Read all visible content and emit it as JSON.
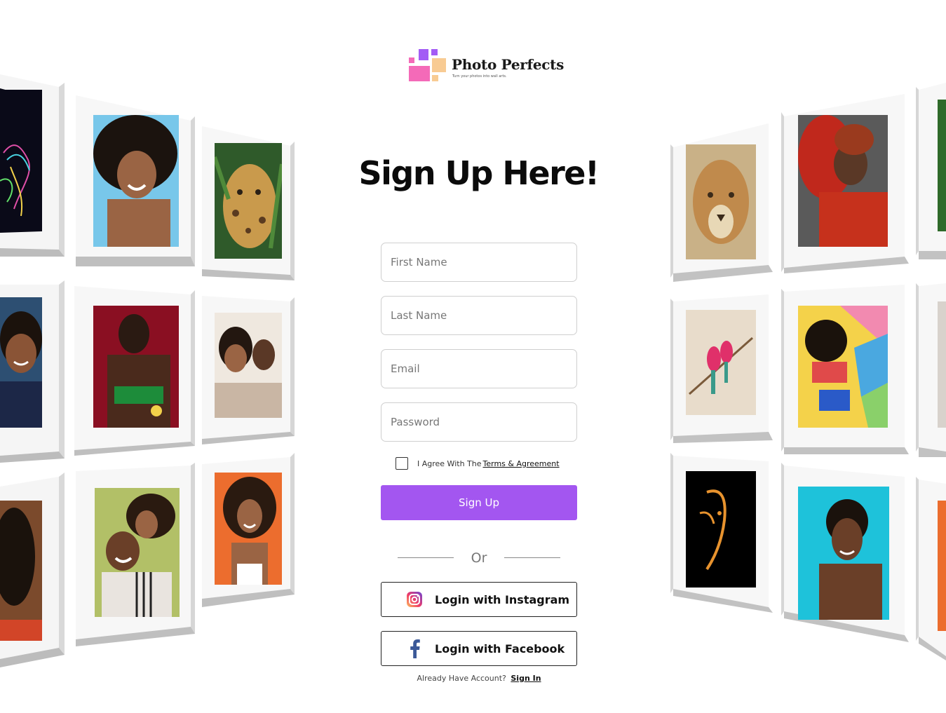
{
  "logo": {
    "brand": "Photo Perfects",
    "tagline": "Turn your photos into wall arts."
  },
  "page": {
    "title": "Sign Up Here!"
  },
  "form": {
    "first_name_placeholder": "First Name",
    "last_name_placeholder": "Last Name",
    "email_placeholder": "Email",
    "password_placeholder": "Password",
    "agree_text": "I Agree With The",
    "terms_link": "Terms & Agreement",
    "submit_label": "Sign Up",
    "divider": "Or",
    "instagram_label": "Login with Instagram",
    "facebook_label": "Login with Facebook",
    "already_text": "Already Have Account?",
    "signin_link": "Sign In"
  },
  "colors": {
    "accent": "#a356f0",
    "logo_purple": "#a35cf5",
    "logo_pink": "#f46ab8",
    "logo_peach": "#f8cb93"
  },
  "gallery": {
    "left": [
      "neon-figure-art-photo",
      "smiling-woman-afro-blue-photo",
      "jaguar-photo",
      "smiling-woman-photo",
      "laughing-woman-red-photo",
      "smiling-couple-selfie-photo",
      "curly-hair-woman-photo",
      "hugging-couple-photo",
      "curly-woman-orange-photo"
    ],
    "right": [
      "lioness-photo",
      "woman-red-hat-photo",
      "leaf-photo",
      "two-birds-branch-photo",
      "woman-colorful-wall-photo",
      "partial-photo",
      "silhouette-face-photo",
      "woman-blue-background-photo",
      "orange-partial-photo"
    ]
  }
}
